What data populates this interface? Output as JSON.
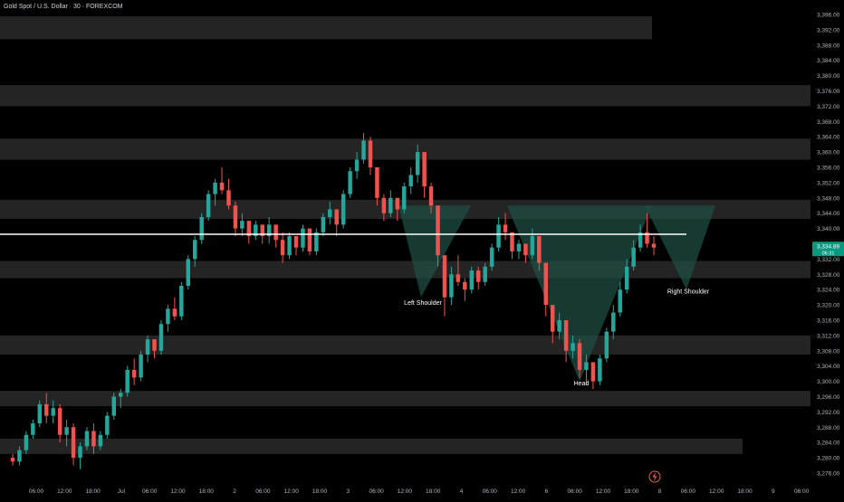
{
  "header": {
    "symbol_title": "Gold Spot / U.S. Dollar · 30 · FOREXCOM"
  },
  "price_badge": {
    "price": "3,334.89",
    "countdown": "06:31"
  },
  "colors": {
    "background": "#000000",
    "zone": "#2a2a2a",
    "up": "#26a69a",
    "down": "#ef5350",
    "pattern": "#1e4d43",
    "neckline": "#ffffff",
    "badge": "#089981",
    "axis_text": "#b2b5be",
    "label_text": "#ffffff"
  },
  "icons": {
    "logo": "lightning-logo-icon"
  },
  "chart_data": {
    "type": "candlestick",
    "title": "Gold Spot / U.S. Dollar · 30 · FOREXCOM",
    "y_ticks": [
      3396,
      3392,
      3388,
      3384,
      3380,
      3376,
      3372,
      3368,
      3364,
      3360,
      3356,
      3352,
      3348,
      3344,
      3340,
      3336,
      3332,
      3328,
      3324,
      3320,
      3316,
      3312,
      3308,
      3304,
      3300,
      3296,
      3292,
      3288,
      3284,
      3280,
      3276
    ],
    "y_tick_labels": [
      "3,396.00",
      "3,392.00",
      "3,388.00",
      "3,384.00",
      "3,380.00",
      "3,376.00",
      "3,372.00",
      "3,368.00",
      "3,364.00",
      "3,360.00",
      "3,356.00",
      "3,352.00",
      "3,348.00",
      "3,344.00",
      "3,340.00",
      "3,336.00",
      "3,332.00",
      "3,328.00",
      "3,324.00",
      "3,320.00",
      "3,316.00",
      "3,312.00",
      "3,308.00",
      "3,304.00",
      "3,300.00",
      "3,296.00",
      "3,292.00",
      "3,288.00",
      "3,284.00",
      "3,280.00",
      "3,276.00"
    ],
    "x_tick_labels": [
      "06:00",
      "12:00",
      "18:00",
      "Jul",
      "06:00",
      "12:00",
      "18:00",
      "2",
      "06:00",
      "12:00",
      "18:00",
      "3",
      "06:00",
      "12:00",
      "18:00",
      "4",
      "06:00",
      "12:00",
      "6",
      "06:00",
      "12:00",
      "18:00",
      "8",
      "06:00",
      "12:00",
      "18:00",
      "9",
      "06:00"
    ],
    "ylim": [
      3274,
      3398
    ],
    "zones": [
      [
        3389.5,
        3395.5
      ],
      [
        3372,
        3377.5
      ],
      [
        3358,
        3363.5
      ],
      [
        3342.5,
        3347.5
      ],
      [
        3327,
        3331.5
      ],
      [
        3307,
        3312
      ],
      [
        3293.5,
        3297.5
      ],
      [
        3281,
        3285
      ]
    ],
    "neckline": 3338.5,
    "current_price": 3334.89,
    "annotations": [
      {
        "text": "Left Shoulder",
        "price": 3320,
        "ref": "left"
      },
      {
        "text": "Head",
        "price": 3299,
        "ref": "head"
      },
      {
        "text": "Right Shoulder",
        "price": 3323,
        "ref": "right"
      }
    ],
    "candles": [
      [
        3280,
        3281,
        3278,
        3279
      ],
      [
        3279,
        3283,
        3278,
        3282
      ],
      [
        3282,
        3287,
        3281,
        3286
      ],
      [
        3286,
        3290,
        3285,
        3289
      ],
      [
        3289,
        3295,
        3288,
        3294
      ],
      [
        3294,
        3297,
        3289,
        3291
      ],
      [
        3291,
        3295,
        3289,
        3293
      ],
      [
        3293,
        3294,
        3284,
        3286
      ],
      [
        3286,
        3290,
        3283,
        3288
      ],
      [
        3288,
        3289,
        3278,
        3280
      ],
      [
        3280,
        3284,
        3277,
        3283
      ],
      [
        3283,
        3288,
        3282,
        3287
      ],
      [
        3287,
        3289,
        3281,
        3283
      ],
      [
        3283,
        3287,
        3282,
        3286
      ],
      [
        3286,
        3292,
        3285,
        3291
      ],
      [
        3291,
        3297,
        3290,
        3296
      ],
      [
        3296,
        3298,
        3293,
        3297
      ],
      [
        3297,
        3304,
        3296,
        3303
      ],
      [
        3303,
        3306,
        3299,
        3301
      ],
      [
        3301,
        3308,
        3300,
        3307
      ],
      [
        3307,
        3312,
        3305,
        3311
      ],
      [
        3311,
        3310,
        3306,
        3308
      ],
      [
        3308,
        3316,
        3307,
        3315
      ],
      [
        3315,
        3320,
        3313,
        3319
      ],
      [
        3319,
        3322,
        3316,
        3317
      ],
      [
        3317,
        3326,
        3316,
        3325
      ],
      [
        3325,
        3333,
        3324,
        3332
      ],
      [
        3332,
        3338,
        3330,
        3337
      ],
      [
        3337,
        3344,
        3336,
        3343
      ],
      [
        3343,
        3350,
        3342,
        3349
      ],
      [
        3349,
        3353,
        3346,
        3352
      ],
      [
        3352,
        3356,
        3349,
        3350
      ],
      [
        3350,
        3353,
        3345,
        3346
      ],
      [
        3346,
        3347,
        3338,
        3340
      ],
      [
        3340,
        3344,
        3338,
        3342
      ],
      [
        3342,
        3341,
        3336,
        3338
      ],
      [
        3338,
        3342,
        3337,
        3341
      ],
      [
        3341,
        3340,
        3336,
        3338
      ],
      [
        3338,
        3343,
        3336,
        3341
      ],
      [
        3341,
        3340,
        3335,
        3337
      ],
      [
        3337,
        3339,
        3331,
        3333
      ],
      [
        3333,
        3339,
        3332,
        3338
      ],
      [
        3338,
        3337,
        3333,
        3335
      ],
      [
        3335,
        3341,
        3334,
        3340
      ],
      [
        3340,
        3339,
        3333,
        3334
      ],
      [
        3334,
        3340,
        3333,
        3339
      ],
      [
        3339,
        3344,
        3338,
        3343
      ],
      [
        3343,
        3347,
        3341,
        3345
      ],
      [
        3345,
        3344,
        3338,
        3341
      ],
      [
        3341,
        3350,
        3340,
        3349
      ],
      [
        3349,
        3356,
        3348,
        3355
      ],
      [
        3355,
        3360,
        3353,
        3358
      ],
      [
        3358,
        3365,
        3357,
        3363
      ],
      [
        3363,
        3364,
        3354,
        3356
      ],
      [
        3356,
        3355,
        3346,
        3348
      ],
      [
        3348,
        3349,
        3342,
        3344
      ],
      [
        3344,
        3350,
        3343,
        3348
      ],
      [
        3348,
        3347,
        3342,
        3345
      ],
      [
        3345,
        3352,
        3344,
        3351
      ],
      [
        3351,
        3356,
        3349,
        3354
      ],
      [
        3354,
        3362,
        3352,
        3360
      ],
      [
        3360,
        3358,
        3348,
        3351
      ],
      [
        3351,
        3352,
        3344,
        3346
      ],
      [
        3346,
        3344,
        3330,
        3333
      ],
      [
        3333,
        3329,
        3317,
        3322
      ],
      [
        3322,
        3330,
        3320,
        3328
      ],
      [
        3328,
        3333,
        3325,
        3326
      ],
      [
        3326,
        3327,
        3321,
        3324
      ],
      [
        3324,
        3330,
        3323,
        3329
      ],
      [
        3329,
        3330,
        3324,
        3326
      ],
      [
        3326,
        3331,
        3325,
        3330
      ],
      [
        3330,
        3336,
        3329,
        3335
      ],
      [
        3335,
        3343,
        3334,
        3341
      ],
      [
        3341,
        3344,
        3337,
        3339
      ],
      [
        3339,
        3338,
        3332,
        3334
      ],
      [
        3334,
        3337,
        3332,
        3336
      ],
      [
        3336,
        3335,
        3331,
        3333
      ],
      [
        3333,
        3340,
        3332,
        3338
      ],
      [
        3338,
        3337,
        3329,
        3331
      ],
      [
        3331,
        3328,
        3317,
        3320
      ],
      [
        3320,
        3319,
        3310,
        3313
      ],
      [
        3313,
        3318,
        3311,
        3316
      ],
      [
        3316,
        3315,
        3305,
        3308
      ],
      [
        3308,
        3312,
        3306,
        3310
      ],
      [
        3310,
        3311,
        3301,
        3303
      ],
      [
        3303,
        3307,
        3299,
        3305
      ],
      [
        3305,
        3304,
        3298,
        3300
      ],
      [
        3300,
        3307,
        3299,
        3306
      ],
      [
        3306,
        3314,
        3305,
        3313
      ],
      [
        3313,
        3320,
        3311,
        3318
      ],
      [
        3318,
        3326,
        3317,
        3324
      ],
      [
        3324,
        3332,
        3323,
        3330
      ],
      [
        3330,
        3337,
        3329,
        3335
      ],
      [
        3335,
        3341,
        3334,
        3339
      ],
      [
        3339,
        3344,
        3335,
        3336
      ],
      [
        3336,
        3338,
        3333,
        3335
      ]
    ]
  }
}
